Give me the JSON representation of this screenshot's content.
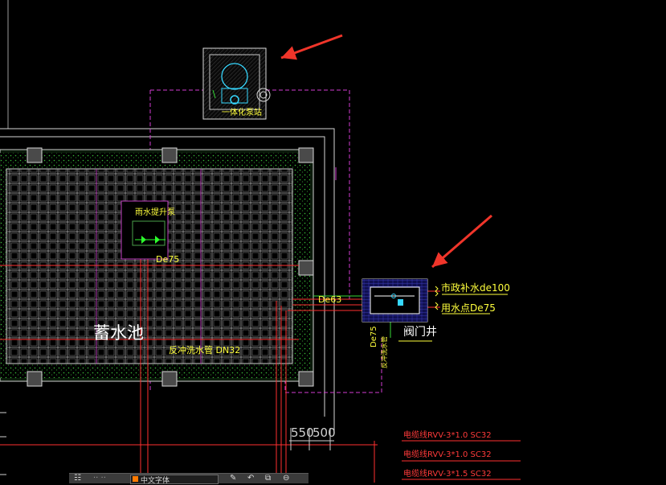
{
  "labels": {
    "pump_room": "一体化泵站",
    "rain_pump": "雨水提升泵",
    "de75_pump": "De75",
    "tank": "蓄水池",
    "backwash": "反冲洗水管  DN32",
    "de63": "De63",
    "de75_vertical": "De75",
    "backwash_vertical": "反冲洗水管",
    "supply_top": "市政补水de100",
    "supply_bottom": "用水点De75",
    "valve_well": "阀门井",
    "dim_a": "550",
    "dim_b": "500"
  },
  "cables": [
    "电缆线RVV-3*1.0 SC32",
    "电缆线RVV-3*1.0 SC32",
    "电缆线RVV-3*1.5 SC32"
  ],
  "statusbar": {
    "layer_name": "中文字体"
  },
  "colors": {
    "background": "#000000",
    "annotation": "#ffff3c",
    "pipe_red": "#ff3030",
    "pipe_magenta": "#d23cd2",
    "arrow": "#f0352a",
    "grid": "#cfcfcf",
    "hatch_green": "#3cc83c"
  }
}
